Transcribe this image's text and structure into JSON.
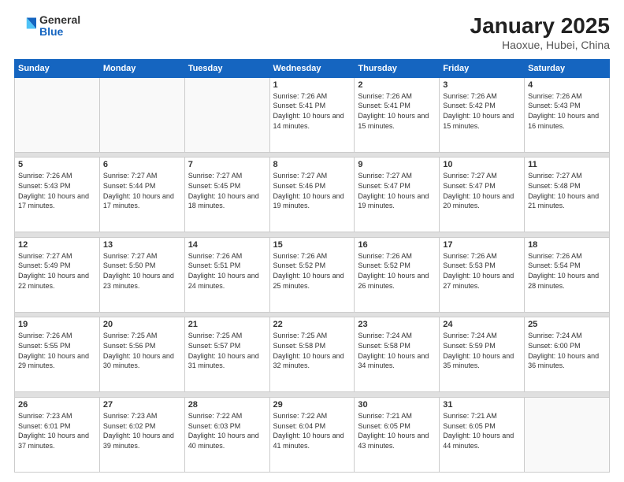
{
  "header": {
    "logo": {
      "general": "General",
      "blue": "Blue"
    },
    "title": "January 2025",
    "subtitle": "Haoxue, Hubei, China"
  },
  "weekdays": [
    "Sunday",
    "Monday",
    "Tuesday",
    "Wednesday",
    "Thursday",
    "Friday",
    "Saturday"
  ],
  "weeks": [
    {
      "days": [
        {
          "num": "",
          "empty": true
        },
        {
          "num": "",
          "empty": true
        },
        {
          "num": "",
          "empty": true
        },
        {
          "num": "1",
          "sunrise": "7:26 AM",
          "sunset": "5:41 PM",
          "daylight": "10 hours and 14 minutes."
        },
        {
          "num": "2",
          "sunrise": "7:26 AM",
          "sunset": "5:41 PM",
          "daylight": "10 hours and 15 minutes."
        },
        {
          "num": "3",
          "sunrise": "7:26 AM",
          "sunset": "5:42 PM",
          "daylight": "10 hours and 15 minutes."
        },
        {
          "num": "4",
          "sunrise": "7:26 AM",
          "sunset": "5:43 PM",
          "daylight": "10 hours and 16 minutes."
        }
      ]
    },
    {
      "days": [
        {
          "num": "5",
          "sunrise": "7:26 AM",
          "sunset": "5:43 PM",
          "daylight": "10 hours and 17 minutes."
        },
        {
          "num": "6",
          "sunrise": "7:27 AM",
          "sunset": "5:44 PM",
          "daylight": "10 hours and 17 minutes."
        },
        {
          "num": "7",
          "sunrise": "7:27 AM",
          "sunset": "5:45 PM",
          "daylight": "10 hours and 18 minutes."
        },
        {
          "num": "8",
          "sunrise": "7:27 AM",
          "sunset": "5:46 PM",
          "daylight": "10 hours and 19 minutes."
        },
        {
          "num": "9",
          "sunrise": "7:27 AM",
          "sunset": "5:47 PM",
          "daylight": "10 hours and 19 minutes."
        },
        {
          "num": "10",
          "sunrise": "7:27 AM",
          "sunset": "5:47 PM",
          "daylight": "10 hours and 20 minutes."
        },
        {
          "num": "11",
          "sunrise": "7:27 AM",
          "sunset": "5:48 PM",
          "daylight": "10 hours and 21 minutes."
        }
      ]
    },
    {
      "days": [
        {
          "num": "12",
          "sunrise": "7:27 AM",
          "sunset": "5:49 PM",
          "daylight": "10 hours and 22 minutes."
        },
        {
          "num": "13",
          "sunrise": "7:27 AM",
          "sunset": "5:50 PM",
          "daylight": "10 hours and 23 minutes."
        },
        {
          "num": "14",
          "sunrise": "7:26 AM",
          "sunset": "5:51 PM",
          "daylight": "10 hours and 24 minutes."
        },
        {
          "num": "15",
          "sunrise": "7:26 AM",
          "sunset": "5:52 PM",
          "daylight": "10 hours and 25 minutes."
        },
        {
          "num": "16",
          "sunrise": "7:26 AM",
          "sunset": "5:52 PM",
          "daylight": "10 hours and 26 minutes."
        },
        {
          "num": "17",
          "sunrise": "7:26 AM",
          "sunset": "5:53 PM",
          "daylight": "10 hours and 27 minutes."
        },
        {
          "num": "18",
          "sunrise": "7:26 AM",
          "sunset": "5:54 PM",
          "daylight": "10 hours and 28 minutes."
        }
      ]
    },
    {
      "days": [
        {
          "num": "19",
          "sunrise": "7:26 AM",
          "sunset": "5:55 PM",
          "daylight": "10 hours and 29 minutes."
        },
        {
          "num": "20",
          "sunrise": "7:25 AM",
          "sunset": "5:56 PM",
          "daylight": "10 hours and 30 minutes."
        },
        {
          "num": "21",
          "sunrise": "7:25 AM",
          "sunset": "5:57 PM",
          "daylight": "10 hours and 31 minutes."
        },
        {
          "num": "22",
          "sunrise": "7:25 AM",
          "sunset": "5:58 PM",
          "daylight": "10 hours and 32 minutes."
        },
        {
          "num": "23",
          "sunrise": "7:24 AM",
          "sunset": "5:58 PM",
          "daylight": "10 hours and 34 minutes."
        },
        {
          "num": "24",
          "sunrise": "7:24 AM",
          "sunset": "5:59 PM",
          "daylight": "10 hours and 35 minutes."
        },
        {
          "num": "25",
          "sunrise": "7:24 AM",
          "sunset": "6:00 PM",
          "daylight": "10 hours and 36 minutes."
        }
      ]
    },
    {
      "days": [
        {
          "num": "26",
          "sunrise": "7:23 AM",
          "sunset": "6:01 PM",
          "daylight": "10 hours and 37 minutes."
        },
        {
          "num": "27",
          "sunrise": "7:23 AM",
          "sunset": "6:02 PM",
          "daylight": "10 hours and 39 minutes."
        },
        {
          "num": "28",
          "sunrise": "7:22 AM",
          "sunset": "6:03 PM",
          "daylight": "10 hours and 40 minutes."
        },
        {
          "num": "29",
          "sunrise": "7:22 AM",
          "sunset": "6:04 PM",
          "daylight": "10 hours and 41 minutes."
        },
        {
          "num": "30",
          "sunrise": "7:21 AM",
          "sunset": "6:05 PM",
          "daylight": "10 hours and 43 minutes."
        },
        {
          "num": "31",
          "sunrise": "7:21 AM",
          "sunset": "6:05 PM",
          "daylight": "10 hours and 44 minutes."
        },
        {
          "num": "",
          "empty": true
        }
      ]
    }
  ],
  "labels": {
    "sunrise": "Sunrise:",
    "sunset": "Sunset:",
    "daylight": "Daylight:"
  }
}
